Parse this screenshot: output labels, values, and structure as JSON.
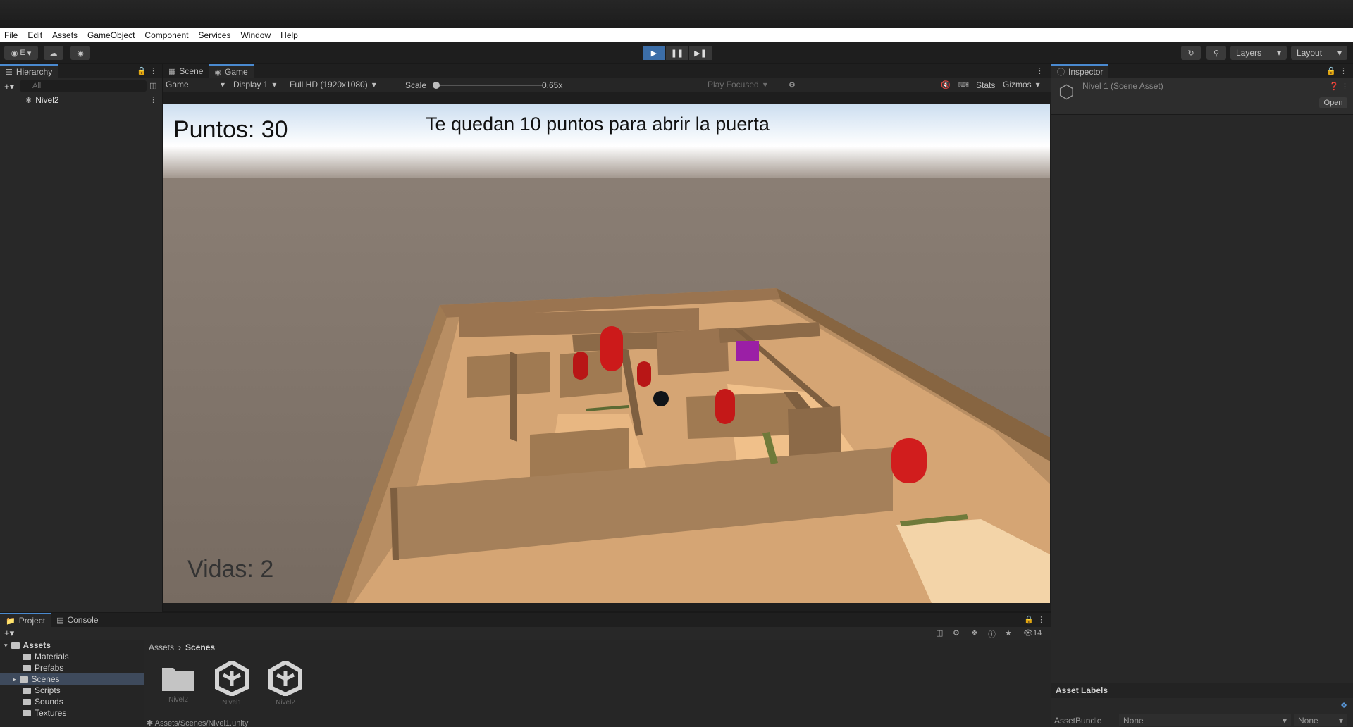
{
  "menubar": [
    "File",
    "Edit",
    "Assets",
    "GameObject",
    "Component",
    "Services",
    "Window",
    "Help"
  ],
  "toolbar": {
    "account_label": "E",
    "layers_label": "Layers",
    "layout_label": "Layout"
  },
  "hierarchy": {
    "tab_label": "Hierarchy",
    "search_placeholder": "All",
    "root_item": "Nivel2"
  },
  "gameview": {
    "tabs": [
      "Scene",
      "Game"
    ],
    "mode_label": "Game",
    "display_label": "Display 1",
    "resolution_label": "Full HD (1920x1080)",
    "scale_label": "Scale",
    "scale_value": "0.65x",
    "play_focused_label": "Play Focused",
    "stats_label": "Stats",
    "gizmos_label": "Gizmos",
    "hud": {
      "score": "Puntos: 30",
      "message": "Te quedan 10 puntos para abrir la puerta",
      "lives": "Vidas: 2"
    }
  },
  "inspector": {
    "tab_label": "Inspector",
    "asset_title": "Nivel 1 (Scene Asset)",
    "open_button": "Open",
    "asset_labels_heading": "Asset Labels",
    "asset_bundle_label": "AssetBundle",
    "asset_bundle_value": "None",
    "asset_variant_value": "None"
  },
  "project": {
    "tabs": [
      "Project",
      "Console"
    ],
    "hidden_count": "14",
    "tree_root": "Assets",
    "tree_items": [
      "Materials",
      "Prefabs",
      "Scenes",
      "Scripts",
      "Sounds",
      "Textures"
    ],
    "tree_selected": "Scenes",
    "breadcrumb": [
      "Assets",
      "Scenes"
    ],
    "assets": [
      "Nivel2",
      "Nivel1",
      "Nivel2"
    ],
    "status_path": "Assets/Scenes/Nivel1.unity"
  },
  "colors": {
    "accent_blue": "#3c6ea8",
    "panel_bg": "#282828",
    "floor": "#c89a62",
    "wall": "#a07a52",
    "enemy_red": "#cc1a1a",
    "door_purple": "#9b1fa6"
  }
}
